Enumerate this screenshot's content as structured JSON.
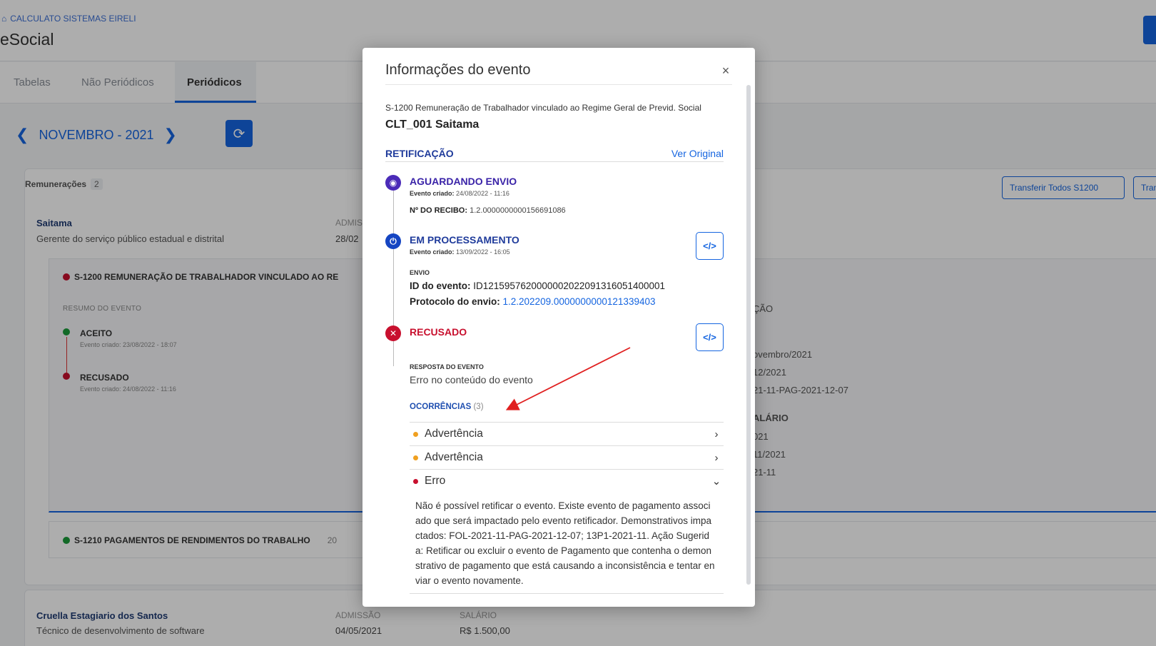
{
  "background": {
    "company": "CALCULATO SISTEMAS EIRELI",
    "app_title": "eSocial",
    "tabs": [
      "Tabelas",
      "Não Periódicos",
      "Periódicos"
    ],
    "period": "NOVEMBRO - 2021",
    "remuneracoes": {
      "title": "Remunerações",
      "count": "2"
    },
    "buttons": [
      "Transferir Todos S1200",
      "Transferir"
    ],
    "employee1": {
      "name": "Saitama",
      "role": "Gerente do serviço público estadual e distrital",
      "adm_label": "ADMISSÃO",
      "adm_value": "28/02"
    },
    "event_header": "S-1200 REMUNERAÇÃO DE TRABALHADOR VINCULADO AO RE",
    "resumo": "RESUMO DO EVENTO",
    "steps": [
      {
        "label": "ACEITO",
        "date": "Evento criado: 23/08/2022 - 18:07"
      },
      {
        "label": "RECUSADO",
        "date": "Evento criado: 24/08/2022 - 11:16"
      }
    ],
    "right_info": [
      "ÇÃO",
      "ovembro/2021",
      "12/2021",
      "21-11-PAG-2021-12-07",
      "ALÁRIO",
      "021",
      "11/2021",
      "21-11"
    ],
    "event2_header": "S-1210 PAGAMENTOS DE RENDIMENTOS DO TRABALHO",
    "event2_extra": "20",
    "employee2": {
      "name": "Cruella Estagiario dos Santos",
      "role": "Técnico de desenvolvimento de software",
      "adm_label": "ADMISSÃO",
      "adm_value": "04/05/2021",
      "sal_label": "SALÁRIO",
      "sal_value": "R$ 1.500,00"
    }
  },
  "modal": {
    "title": "Informações do evento",
    "close": "×",
    "event_name": "S-1200 Remuneração de Trabalhador vinculado ao Regime Geral de Previd. Social",
    "worker": "CLT_001 Saitama",
    "section": "RETIFICAÇÃO",
    "ver_original": "Ver Original",
    "statuses": {
      "aguardando": {
        "title": "AGUARDANDO ENVIO",
        "date_label": "Evento criado:",
        "date": "24/08/2022 - 11:16",
        "recibo_label": "Nº DO RECIBO:",
        "recibo": "1.2.0000000000156691086"
      },
      "processamento": {
        "title": "EM PROCESSAMENTO",
        "date_label": "Evento criado:",
        "date": "13/09/2022 - 16:05",
        "envio_label": "ENVIO",
        "id_label": "ID do evento:",
        "id_value": "ID1215957620000002022091316051400001",
        "protocolo_label": "Protocolo do envio:",
        "protocolo_value": "1.2.202209.0000000000121339403"
      },
      "recusado": {
        "title": "RECUSADO",
        "resposta_label": "RESPOSTA DO EVENTO",
        "resposta_value": "Erro no conteúdo do evento"
      }
    },
    "code_button": "</>",
    "ocorrencias": {
      "label": "OCORRÊNCIAS",
      "count": "(3)",
      "items": [
        {
          "label": "Advertência",
          "chevron": "›"
        },
        {
          "label": "Advertência",
          "chevron": "›"
        },
        {
          "label": "Erro",
          "chevron": "⌄"
        }
      ],
      "detail": "Não é possível retificar o evento. Existe evento de pagamento associado que será impactado pelo evento retificador. Demonstrativos impactados: FOL-2021-11-PAG-2021-12-07; 13P1-2021-11. Ação Sugerida: Retificar ou excluir o evento de Pagamento que contenha o demonstrativo de pagamento que está causando a inconsistência e tentar enviar o evento novamente."
    }
  },
  "colors": {
    "primary": "#1565e0",
    "danger": "#c8102e",
    "warning": "#f0a020",
    "purple": "#3a23a8"
  }
}
